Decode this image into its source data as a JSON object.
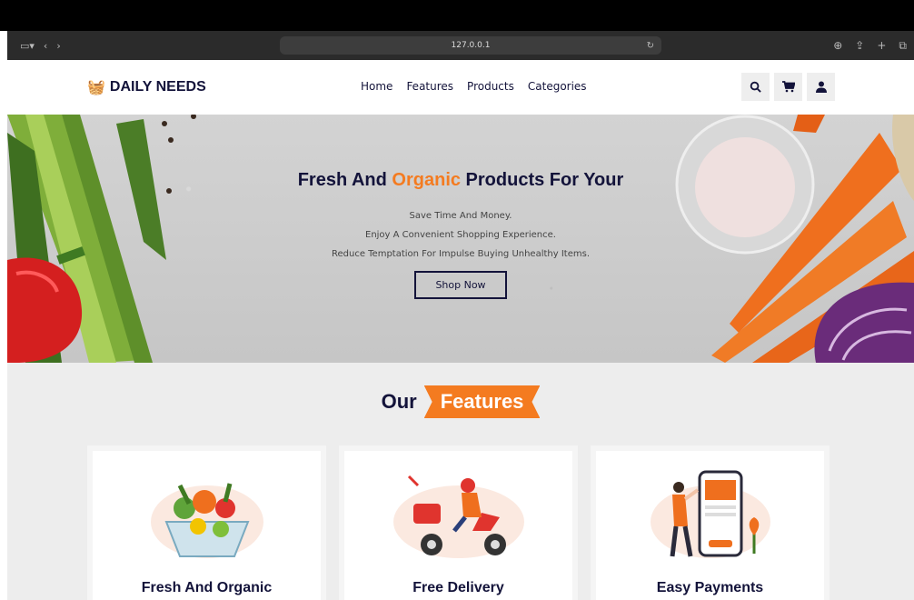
{
  "browser": {
    "url": "127.0.0.1"
  },
  "brand": {
    "name": "DAILY NEEDS"
  },
  "nav": [
    {
      "label": "Home"
    },
    {
      "label": "Features"
    },
    {
      "label": "Products"
    },
    {
      "label": "Categories"
    }
  ],
  "hero": {
    "title_pre": "Fresh And ",
    "title_accent": "Organic",
    "title_post": " Products For Your",
    "line1": "Save Time And Money.",
    "line2": "Enjoy A Convenient Shopping Experience.",
    "line3": "Reduce Temptation For Impulse Buying Unhealthy Items.",
    "cta": "Shop Now"
  },
  "features": {
    "heading_prefix": "Our",
    "heading_highlight": "Features",
    "cards": [
      {
        "title": "Fresh And Organic"
      },
      {
        "title": "Free Delivery"
      },
      {
        "title": "Easy Payments"
      }
    ]
  },
  "colors": {
    "accent": "#f47b20",
    "navy": "#13133a"
  }
}
